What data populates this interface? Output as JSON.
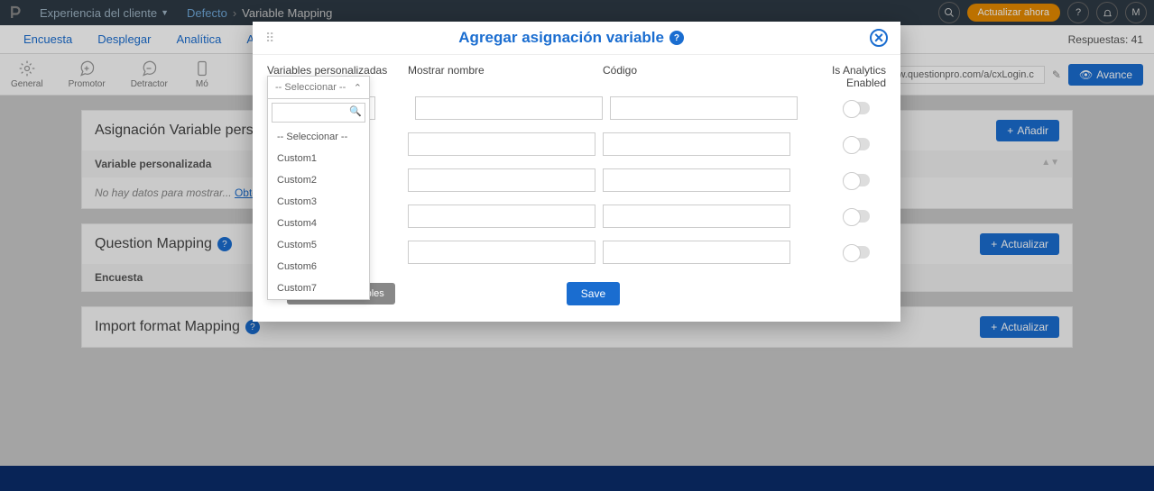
{
  "top": {
    "nav_item": "Experiencia del cliente",
    "bc1": "Defecto",
    "bc2": "Variable Mapping",
    "update": "Actualizar ahora",
    "avatar": "M"
  },
  "tabs": {
    "t1": "Encuesta",
    "t2": "Desplegar",
    "t3": "Analítica",
    "t4": "Acción",
    "resp": "Respuestas: 41"
  },
  "tools": {
    "general": "General",
    "promotor": "Promotor",
    "detractor": "Detractor",
    "movil": "Mó",
    "url": "s://www.questionpro.com/a/cxLogin.c",
    "avance": "Avance"
  },
  "sec1": {
    "title": "Asignación Variable personal",
    "sub": "Variable personalizada",
    "empty": "No hay datos para mostrar...",
    "link": "Obtener más i",
    "btn": "Añadir"
  },
  "sec2": {
    "title": "Question Mapping",
    "sub": "Encuesta",
    "btn": "Actualizar"
  },
  "sec3": {
    "title": "Import format Mapping",
    "btn": "Actualizar"
  },
  "modal": {
    "title": "Agregar asignación variable",
    "h1": "Variables personalizadas",
    "h2": "Mostrar nombre",
    "h3": "Código",
    "h4": "Is Analytics Enabled",
    "select_placeholder": "-- Seleccionar --",
    "add": "Add More Variables",
    "save": "Save"
  },
  "dd_options": [
    "-- Seleccionar --",
    "Custom1",
    "Custom2",
    "Custom3",
    "Custom4",
    "Custom5",
    "Custom6",
    "Custom7"
  ]
}
